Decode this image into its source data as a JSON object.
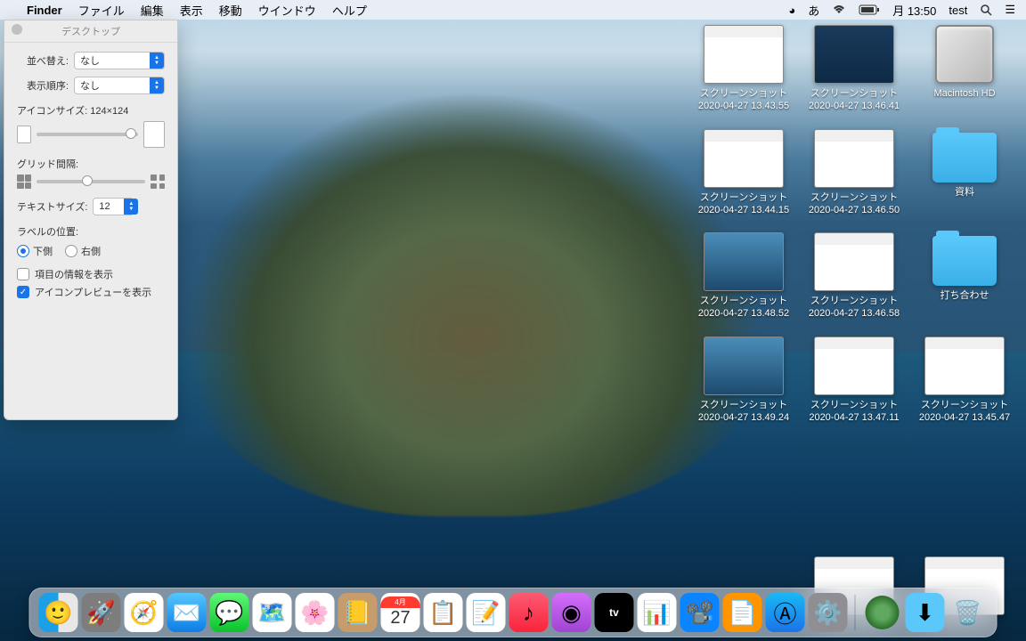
{
  "menubar": {
    "app_name": "Finder",
    "items": [
      "ファイル",
      "編集",
      "表示",
      "移動",
      "ウインドウ",
      "ヘルプ"
    ],
    "right": {
      "input_indicator": "あ",
      "battery_icon": "battery",
      "clock": "月 13:50",
      "user": "test"
    }
  },
  "view_options": {
    "title": "デスクトップ",
    "sort_label": "並べ替え:",
    "sort_value": "なし",
    "order_label": "表示順序:",
    "order_value": "なし",
    "icon_size_label": "アイコンサイズ: ",
    "icon_size_value": "124×124",
    "grid_label": "グリッド間隔:",
    "text_size_label": "テキストサイズ:",
    "text_size_value": "12",
    "label_pos_label": "ラベルの位置:",
    "radio_bottom": "下側",
    "radio_right": "右側",
    "check_info": "項目の情報を表示",
    "check_preview": "アイコンプレビューを表示",
    "radio_selected": "bottom",
    "check_info_checked": false,
    "check_preview_checked": true
  },
  "desktop_items": [
    [
      {
        "type": "screenshot",
        "thumb": "window",
        "name": "スクリーンショット",
        "date": "2020-04-27 13.43.55"
      },
      {
        "type": "screenshot",
        "thumb": "dark",
        "name": "スクリーンショット",
        "date": "2020-04-27 13.46.41"
      },
      {
        "type": "hd",
        "name": "Macintosh HD",
        "date": ""
      }
    ],
    [
      {
        "type": "screenshot",
        "thumb": "window",
        "name": "スクリーンショット",
        "date": "2020-04-27 13.44.15"
      },
      {
        "type": "screenshot",
        "thumb": "window",
        "name": "スクリーンショット",
        "date": "2020-04-27 13.46.50"
      },
      {
        "type": "folder",
        "name": "資料",
        "date": ""
      }
    ],
    [
      {
        "type": "screenshot",
        "thumb": "desktop",
        "name": "スクリーンショット",
        "date": "2020-04-27 13.48.52"
      },
      {
        "type": "screenshot",
        "thumb": "window",
        "name": "スクリーンショット",
        "date": "2020-04-27 13.46.58"
      },
      {
        "type": "folder",
        "name": "打ち合わせ",
        "date": ""
      }
    ],
    [
      {
        "type": "screenshot",
        "thumb": "desktop",
        "name": "スクリーンショット",
        "date": "2020-04-27 13.49.24"
      },
      {
        "type": "screenshot",
        "thumb": "window",
        "name": "スクリーンショット",
        "date": "2020-04-27 13.47.11"
      },
      {
        "type": "screenshot",
        "thumb": "window",
        "name": "スクリーンショット",
        "date": "2020-04-27 13.45.47"
      }
    ]
  ],
  "desktop_row5": [
    {
      "type": "screenshot",
      "thumb": "window",
      "name": "",
      "date": ""
    },
    {
      "type": "screenshot",
      "thumb": "window",
      "name": "",
      "date": ""
    }
  ],
  "dock": {
    "calendar_month": "4月",
    "calendar_day": "27",
    "tv_label": "tv",
    "items": [
      "finder",
      "launchpad",
      "safari",
      "mail",
      "messages",
      "maps",
      "photos",
      "contacts",
      "calendar",
      "reminders",
      "notes",
      "music",
      "podcasts",
      "tv",
      "numbers",
      "keynote",
      "pages",
      "appstore",
      "settings"
    ],
    "right_items": [
      "cisco",
      "downloads",
      "trash"
    ]
  }
}
